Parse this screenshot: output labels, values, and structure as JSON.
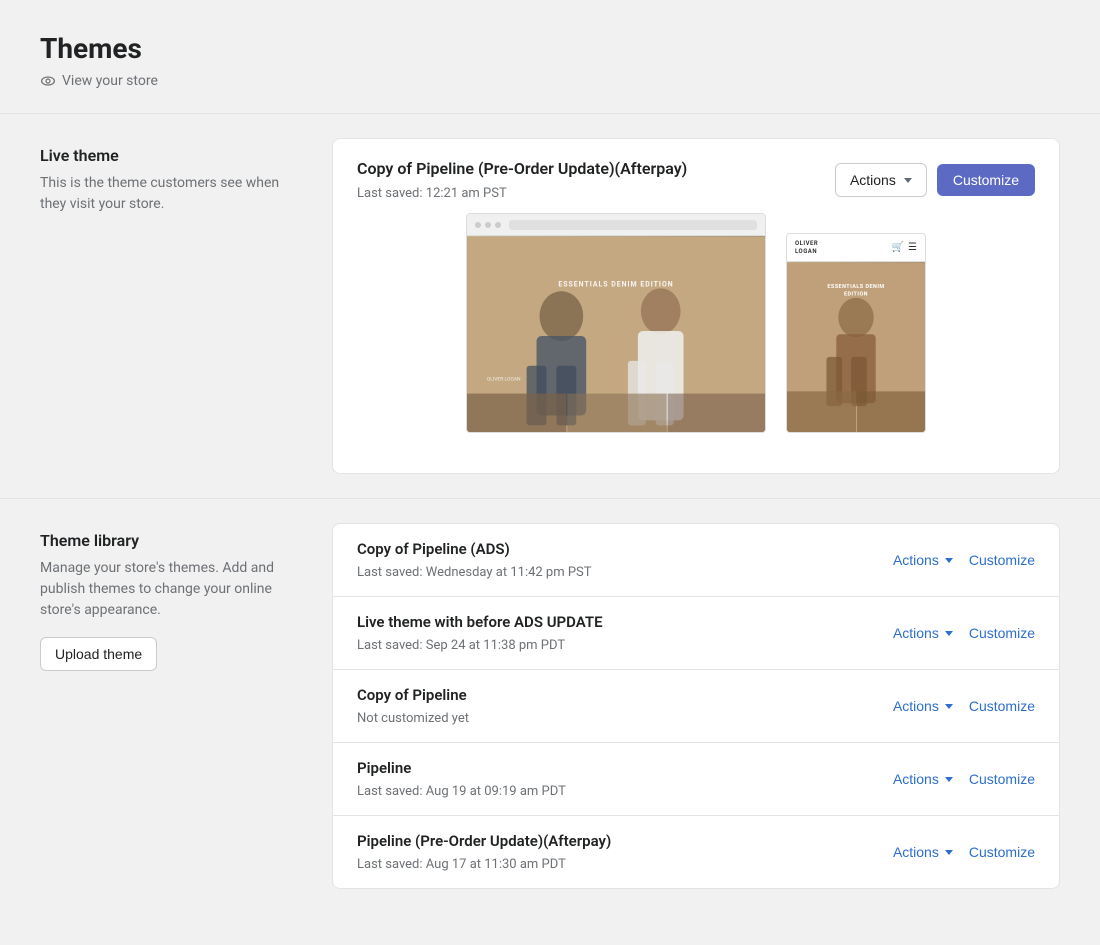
{
  "page": {
    "title": "Themes",
    "view_store_label": "View your store"
  },
  "live_theme": {
    "section_title": "Live theme",
    "section_description": "This is the theme customers see when they visit your store.",
    "theme_name": "Copy of Pipeline (Pre-Order Update)(Afterpay)",
    "last_saved": "Last saved: 12:21 am PST",
    "actions_label": "Actions",
    "customize_label": "Customize",
    "preview_store_name_line1": "OLIVER",
    "preview_store_name_line2": "LOGAN",
    "preview_denim_text": "ESSENTIALS DENIM EDITION"
  },
  "theme_library": {
    "section_title": "Theme library",
    "section_description": "Manage your store's themes. Add and publish themes to change your online store's appearance.",
    "upload_label": "Upload theme",
    "themes": [
      {
        "name": "Copy of Pipeline (ADS)",
        "last_saved": "Last saved: Wednesday at 11:42 pm PST",
        "actions_label": "Actions",
        "customize_label": "Customize"
      },
      {
        "name": "Live theme with before ADS UPDATE",
        "last_saved": "Last saved: Sep 24 at 11:38 pm PDT",
        "actions_label": "Actions",
        "customize_label": "Customize"
      },
      {
        "name": "Copy of Pipeline",
        "last_saved": "Not customized yet",
        "actions_label": "Actions",
        "customize_label": "Customize"
      },
      {
        "name": "Pipeline",
        "last_saved": "Last saved: Aug 19 at 09:19 am PDT",
        "actions_label": "Actions",
        "customize_label": "Customize"
      },
      {
        "name": "Pipeline (Pre-Order Update)(Afterpay)",
        "last_saved": "Last saved: Aug 17 at 11:30 am PDT",
        "actions_label": "Actions",
        "customize_label": "Customize"
      }
    ]
  }
}
